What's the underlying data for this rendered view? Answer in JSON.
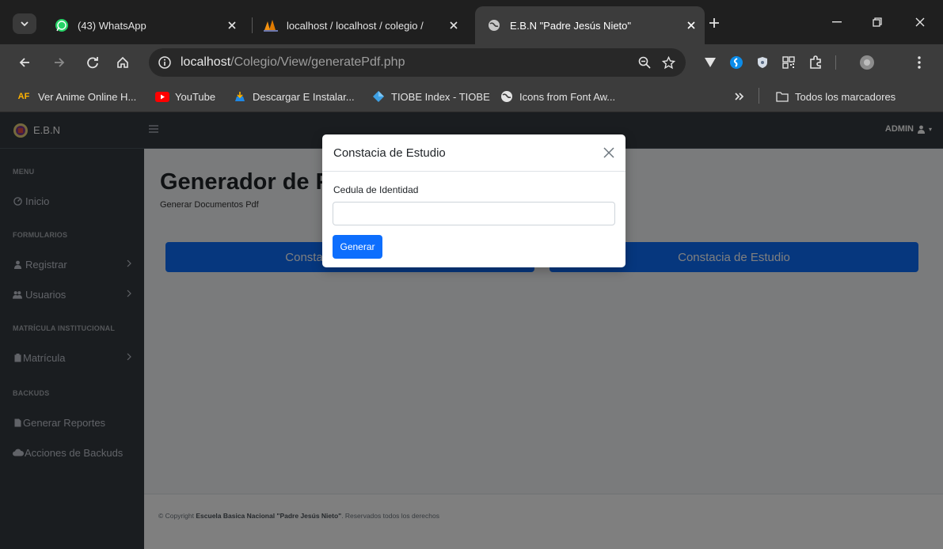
{
  "browser": {
    "tabs": [
      {
        "title": "(43) WhatsApp"
      },
      {
        "title": "localhost / localhost / colegio / "
      },
      {
        "title": "E.B.N \"Padre Jesús Nieto\""
      }
    ],
    "address": {
      "host": "localhost",
      "path": "/Colegio/View/generatePdf.php"
    },
    "bookmarks": [
      {
        "label": "Ver Anime Online H..."
      },
      {
        "label": "YouTube"
      },
      {
        "label": "Descargar E Instalar..."
      },
      {
        "label": "TIOBE Index - TIOBE"
      },
      {
        "label": "Icons from Font Aw..."
      }
    ],
    "all_bookmarks": "Todos los marcadores",
    "bookmark_badge": "AF",
    "colors": {
      "chrome_dark": "#1f1f1f",
      "toolbar": "#3c3c3c"
    }
  },
  "app": {
    "brand": "E.B.N",
    "user_menu": "ADMIN",
    "sidebar": {
      "sections": [
        {
          "header": "MENU",
          "items": [
            {
              "label": "Inicio"
            }
          ]
        },
        {
          "header": "FORMULARIOS",
          "items": [
            {
              "label": "Registrar"
            },
            {
              "label": "Usuarios"
            }
          ]
        },
        {
          "header": "MATRÍCULA INSTITUCIONAL",
          "items": [
            {
              "label": "Matrícula"
            }
          ]
        },
        {
          "header": "BACKUDS",
          "items": [
            {
              "label": "Generar Reportes"
            },
            {
              "label": "Acciones de Backuds"
            }
          ]
        }
      ]
    },
    "main": {
      "title": "Generador de Pdf",
      "subtitle": "Generar Documentos Pdf",
      "buttons": [
        {
          "label": "Constacia de Inscripción"
        },
        {
          "label": "Constacia de Estudio"
        }
      ]
    },
    "footer": {
      "prefix": "© Copyright ",
      "org": "Escuela Basica Nacional \"Padre Jesús Nieto\"",
      "suffix": ". Reservados todos los derechos"
    },
    "colors": {
      "primary": "#0d6efd",
      "sidebar": "#343a40"
    }
  },
  "modal": {
    "title": "Constacia de Estudio",
    "field_label": "Cedula de Identidad",
    "field_value": "",
    "submit": "Generar"
  }
}
